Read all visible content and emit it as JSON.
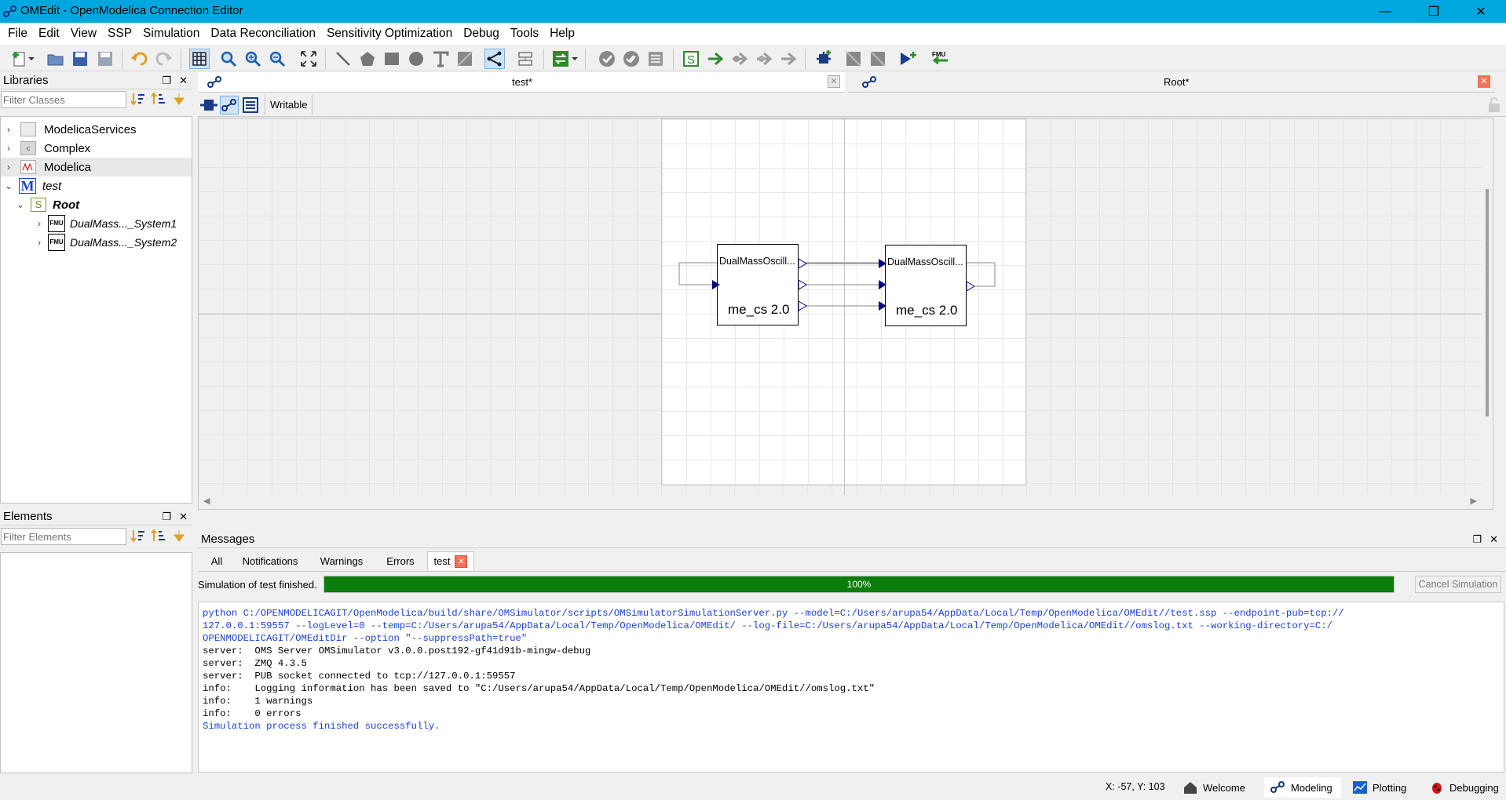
{
  "window": {
    "title": "OMEdit - OpenModelica Connection Editor",
    "controls": [
      "—",
      "❐",
      "✕"
    ]
  },
  "menu": [
    "File",
    "Edit",
    "View",
    "SSP",
    "Simulation",
    "Data Reconciliation",
    "Sensitivity Optimization",
    "Debug",
    "Tools",
    "Help"
  ],
  "libraries": {
    "header": "Libraries",
    "filter_placeholder": "Filter Classes",
    "items": [
      {
        "label": "ModelicaServices"
      },
      {
        "label": "Complex"
      },
      {
        "label": "Modelica"
      },
      {
        "label": "test"
      },
      {
        "label": "Root"
      },
      {
        "label": "DualMass..._System1"
      },
      {
        "label": "DualMass..._System2"
      }
    ]
  },
  "elements": {
    "header": "Elements",
    "filter_placeholder": "Filter Elements"
  },
  "editor": {
    "tabs": [
      {
        "label": "test*"
      },
      {
        "label": "Root*"
      }
    ],
    "writable_label": "Writable",
    "components": [
      {
        "name": "DualMassOscill...",
        "version": "me_cs 2.0"
      },
      {
        "name": "DualMassOscill...",
        "version": "me_cs 2.0"
      }
    ]
  },
  "messages": {
    "header": "Messages",
    "tabs": [
      "All",
      "Notifications",
      "Warnings",
      "Errors",
      "test"
    ],
    "status": "Simulation of test finished.",
    "progress": 100,
    "progress_label": "100%",
    "cancel_label": "Cancel Simulation",
    "log": [
      {
        "text": "python C:/OPENMODELICAGIT/OpenModelica/build/share/OMSimulator/scripts/OMSimulatorSimulationServer.py --model=C:/Users/arupa54/AppData/Local/Temp/OpenModelica/OMEdit//test.ssp --endpoint-pub=tcp://",
        "color": "#1a3fd6"
      },
      {
        "text": "127.0.0.1:59557 --logLevel=0 --temp=C:/Users/arupa54/AppData/Local/Temp/OpenModelica/OMEdit/ --log-file=C:/Users/arupa54/AppData/Local/Temp/OpenModelica/OMEdit//omslog.txt --working-directory=C:/",
        "color": "#1a3fd6"
      },
      {
        "text": "OPENMODELICAGIT/OMEditDir --option \"--suppressPath=true\"",
        "color": "#1a3fd6"
      },
      {
        "text": "server:  OMS Server OMSimulator v3.0.0.post192-gf41d91b-mingw-debug",
        "color": "#000000"
      },
      {
        "text": "server:  ZMQ 4.3.5",
        "color": "#000000"
      },
      {
        "text": "server:  PUB socket connected to tcp://127.0.0.1:59557",
        "color": "#000000"
      },
      {
        "text": "info:    Logging information has been saved to \"C:/Users/arupa54/AppData/Local/Temp/OpenModelica/OMEdit//omslog.txt\"",
        "color": "#000000"
      },
      {
        "text": "info:    1 warnings",
        "color": "#000000"
      },
      {
        "text": "info:    0 errors",
        "color": "#000000"
      },
      {
        "text": "Simulation process finished successfully.",
        "color": "#1a3fd6"
      }
    ]
  },
  "statusbar": {
    "coords": "X: -57, Y: 103",
    "perspectives": [
      "Welcome",
      "Modeling",
      "Plotting",
      "Debugging"
    ]
  },
  "colors": {
    "titlebar": "#00a7de",
    "progress": "#0a7d0a",
    "connector": "#00007f"
  }
}
